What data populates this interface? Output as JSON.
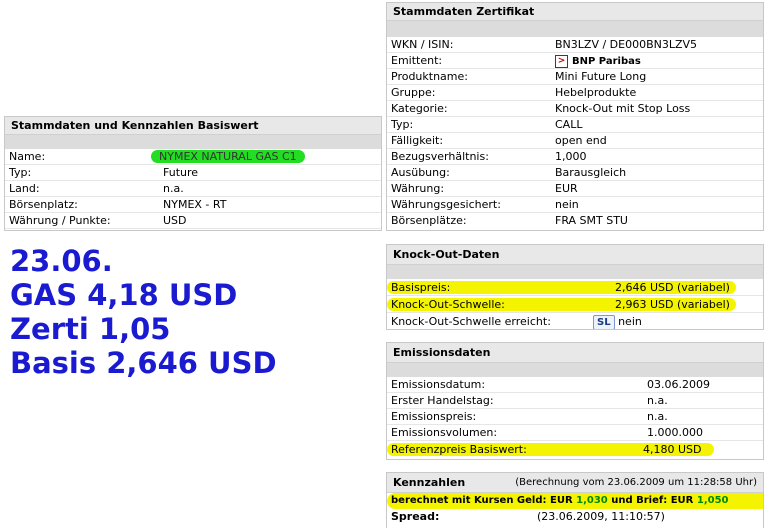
{
  "basiswert": {
    "title": "Stammdaten und Kennzahlen Basiswert",
    "rows": [
      {
        "label": "Name:",
        "value": "NYMEX NATURAL GAS C1"
      },
      {
        "label": "Typ:",
        "value": "Future"
      },
      {
        "label": "Land:",
        "value": "n.a."
      },
      {
        "label": "Börsenplatz:",
        "value": "NYMEX - RT"
      },
      {
        "label": "Währung / Punkte:",
        "value": "USD"
      }
    ]
  },
  "notes": {
    "line1": "23.06.",
    "line2": "GAS 4,18 USD",
    "line3": "Zerti 1,05",
    "line4": "Basis 2,646 USD"
  },
  "zertifikat": {
    "title": "Stammdaten Zertifikat",
    "rows": [
      {
        "label": "WKN / ISIN:",
        "value": "BN3LZV / DE000BN3LZV5"
      },
      {
        "label": "Emittent:",
        "value": "BNP Paribas",
        "icon": "emittent-logo-icon",
        "icon_glyph": ">"
      },
      {
        "label": "Produktname:",
        "value": "Mini Future Long"
      },
      {
        "label": "Gruppe:",
        "value": "Hebelprodukte"
      },
      {
        "label": "Kategorie:",
        "value": "Knock-Out mit Stop Loss"
      },
      {
        "label": "Typ:",
        "value": "CALL"
      },
      {
        "label": "Fälligkeit:",
        "value": "open end"
      },
      {
        "label": "Bezugsverhältnis:",
        "value": "1,000"
      },
      {
        "label": "Ausübung:",
        "value": "Barausgleich"
      },
      {
        "label": "Währung:",
        "value": "EUR"
      },
      {
        "label": "Währungsgesichert:",
        "value": "nein"
      },
      {
        "label": "Börsenplätze:",
        "value": "FRA SMT STU"
      }
    ]
  },
  "knockout": {
    "title": "Knock-Out-Daten",
    "rows": [
      {
        "label": "Basispreis:",
        "value": "2,646 USD (variabel)"
      },
      {
        "label": "Knock-Out-Schwelle:",
        "value": "2,963 USD (variabel)"
      },
      {
        "label": "Knock-Out-Schwelle erreicht:",
        "badge": "SL",
        "value": "nein"
      }
    ]
  },
  "emission": {
    "title": "Emissionsdaten",
    "rows": [
      {
        "label": "Emissionsdatum:",
        "value": "03.06.2009"
      },
      {
        "label": "Erster Handelstag:",
        "value": "n.a."
      },
      {
        "label": "Emissionspreis:",
        "value": "n.a."
      },
      {
        "label": "Emissionsvolumen:",
        "value": "1.000.000"
      },
      {
        "label": "Referenzpreis Basiswert:",
        "value": "4,180 USD"
      }
    ]
  },
  "kennzahlen": {
    "title": "Kennzahlen",
    "calc_note": "(Berechnung vom 23.06.2009 um 11:28:58 Uhr)",
    "computed_prefix": "berechnet mit Kursen Geld: EUR ",
    "geld": "1,030",
    "computed_mid": " und Brief: EUR ",
    "brief": "1,050",
    "spread_label": "Spread:",
    "spread_value": "(23.06.2009, 11:10:57)"
  },
  "colors": {
    "highlight_yellow": "#f4f400",
    "highlight_green": "#22dd22",
    "note_blue": "#1a1ad0"
  }
}
